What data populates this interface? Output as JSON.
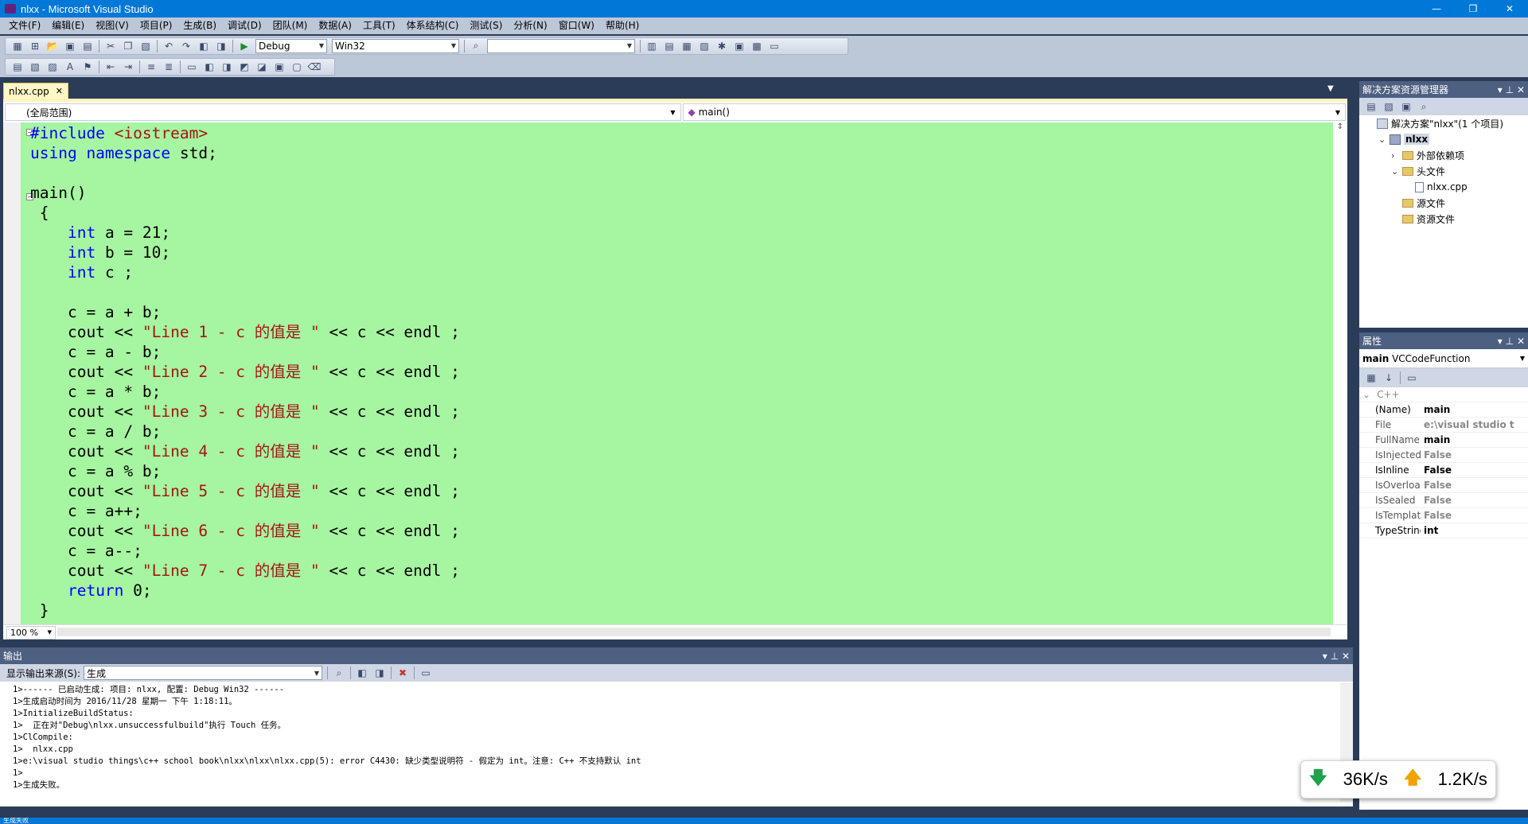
{
  "window": {
    "title": "nlxx - Microsoft Visual Studio",
    "min": "—",
    "restore": "❐",
    "close": "✕"
  },
  "menu": [
    "文件(F)",
    "编辑(E)",
    "视图(V)",
    "项目(P)",
    "生成(B)",
    "调试(D)",
    "团队(M)",
    "数据(A)",
    "工具(T)",
    "体系结构(C)",
    "测试(S)",
    "分析(N)",
    "窗口(W)",
    "帮助(H)"
  ],
  "toolbar": {
    "config": "Debug",
    "platform": "Win32",
    "find": ""
  },
  "doc_tab": {
    "label": "nlxx.cpp",
    "close": "✕"
  },
  "nav": {
    "scope": "(全局范围)",
    "member": "main()"
  },
  "code_lines": [
    [
      {
        "t": "#include ",
        "c": "pp"
      },
      {
        "t": "<iostream>",
        "c": "inc"
      }
    ],
    [
      {
        "t": "using namespace",
        "c": "kw"
      },
      {
        "t": " std;",
        "c": ""
      }
    ],
    [],
    [
      {
        "t": "main()",
        "c": ""
      }
    ],
    [
      {
        "t": " {",
        "c": ""
      }
    ],
    [
      {
        "t": "    ",
        "c": ""
      },
      {
        "t": "int",
        "c": "kw"
      },
      {
        "t": " a = 21;",
        "c": ""
      }
    ],
    [
      {
        "t": "    ",
        "c": ""
      },
      {
        "t": "int",
        "c": "kw"
      },
      {
        "t": " b = 10;",
        "c": ""
      }
    ],
    [
      {
        "t": "    ",
        "c": ""
      },
      {
        "t": "int",
        "c": "kw"
      },
      {
        "t": " c ;",
        "c": ""
      }
    ],
    [],
    [
      {
        "t": "    c = a + b;",
        "c": ""
      }
    ],
    [
      {
        "t": "    cout << ",
        "c": ""
      },
      {
        "t": "\"Line 1 - c 的值是 \"",
        "c": "st"
      },
      {
        "t": " << c << endl ;",
        "c": ""
      }
    ],
    [
      {
        "t": "    c = a - b;",
        "c": ""
      }
    ],
    [
      {
        "t": "    cout << ",
        "c": ""
      },
      {
        "t": "\"Line 2 - c 的值是 \"",
        "c": "st"
      },
      {
        "t": " << c << endl ;",
        "c": ""
      }
    ],
    [
      {
        "t": "    c = a * b;",
        "c": ""
      }
    ],
    [
      {
        "t": "    cout << ",
        "c": ""
      },
      {
        "t": "\"Line 3 - c 的值是 \"",
        "c": "st"
      },
      {
        "t": " << c << endl ;",
        "c": ""
      }
    ],
    [
      {
        "t": "    c = a / b;",
        "c": ""
      }
    ],
    [
      {
        "t": "    cout << ",
        "c": ""
      },
      {
        "t": "\"Line 4 - c 的值是 \"",
        "c": "st"
      },
      {
        "t": " << c << endl ;",
        "c": ""
      }
    ],
    [
      {
        "t": "    c = a % b;",
        "c": ""
      }
    ],
    [
      {
        "t": "    cout << ",
        "c": ""
      },
      {
        "t": "\"Line 5 - c 的值是 \"",
        "c": "st"
      },
      {
        "t": " << c << endl ;",
        "c": ""
      }
    ],
    [
      {
        "t": "    c = a++;",
        "c": ""
      }
    ],
    [
      {
        "t": "    cout << ",
        "c": ""
      },
      {
        "t": "\"Line 6 - c 的值是 \"",
        "c": "st"
      },
      {
        "t": " << c << endl ;",
        "c": ""
      }
    ],
    [
      {
        "t": "    c = a--;",
        "c": ""
      }
    ],
    [
      {
        "t": "    cout << ",
        "c": ""
      },
      {
        "t": "\"Line 7 - c 的值是 \"",
        "c": "st"
      },
      {
        "t": " << c << endl ;",
        "c": ""
      }
    ],
    [
      {
        "t": "    ",
        "c": ""
      },
      {
        "t": "return",
        "c": "kw"
      },
      {
        "t": " 0;",
        "c": ""
      }
    ],
    [
      {
        "t": " }",
        "c": ""
      }
    ]
  ],
  "zoom": "100 %",
  "solution_explorer": {
    "title": "解决方案资源管理器",
    "items": [
      {
        "label": "解决方案\"nlxx\"(1 个项目)",
        "indent": 0,
        "icon": "solution",
        "exp": ""
      },
      {
        "label": "nlxx",
        "indent": 1,
        "icon": "project",
        "exp": "⌄"
      },
      {
        "label": "外部依赖项",
        "indent": 2,
        "icon": "folder",
        "exp": "›"
      },
      {
        "label": "头文件",
        "indent": 2,
        "icon": "folder",
        "exp": "⌄"
      },
      {
        "label": "nlxx.cpp",
        "indent": 3,
        "icon": "file",
        "exp": ""
      },
      {
        "label": "源文件",
        "indent": 2,
        "icon": "folder",
        "exp": ""
      },
      {
        "label": "资源文件",
        "indent": 2,
        "icon": "folder",
        "exp": ""
      }
    ]
  },
  "properties": {
    "title": "属性",
    "object_name": "main",
    "object_type": "VCCodeFunction",
    "category": "C++",
    "rows": [
      {
        "name": "(Name)",
        "value": "main"
      },
      {
        "name": "File",
        "value": "e:\\visual studio t"
      },
      {
        "name": "FullName",
        "value": "main"
      },
      {
        "name": "IsInjected",
        "value": "False"
      },
      {
        "name": "IsInline",
        "value": "False"
      },
      {
        "name": "IsOverloade",
        "value": "False"
      },
      {
        "name": "IsSealed",
        "value": "False"
      },
      {
        "name": "IsTemplate",
        "value": "False"
      },
      {
        "name": "TypeString",
        "value": "int"
      }
    ]
  },
  "output": {
    "title": "输出",
    "source_label": "显示输出来源(S):",
    "source_value": "生成",
    "lines": [
      "1>------ 已启动生成: 项目: nlxx, 配置: Debug Win32 ------",
      "1>生成启动时间为 2016/11/28 星期一 下午 1:18:11。",
      "1>InitializeBuildStatus:",
      "1>  正在对\"Debug\\nlxx.unsuccessfulbuild\"执行 Touch 任务。",
      "1>ClCompile:",
      "1>  nlxx.cpp",
      "1>e:\\visual studio things\\c++ school book\\nlxx\\nlxx\\nlxx.cpp(5): error C4430: 缺少类型说明符 - 假定为 int。注意: C++ 不支持默认 int",
      "1>",
      "1>生成失败。"
    ]
  },
  "speed": {
    "down": "36K/s",
    "up": "1.2K/s"
  },
  "status": {
    "text": "生成失败"
  }
}
